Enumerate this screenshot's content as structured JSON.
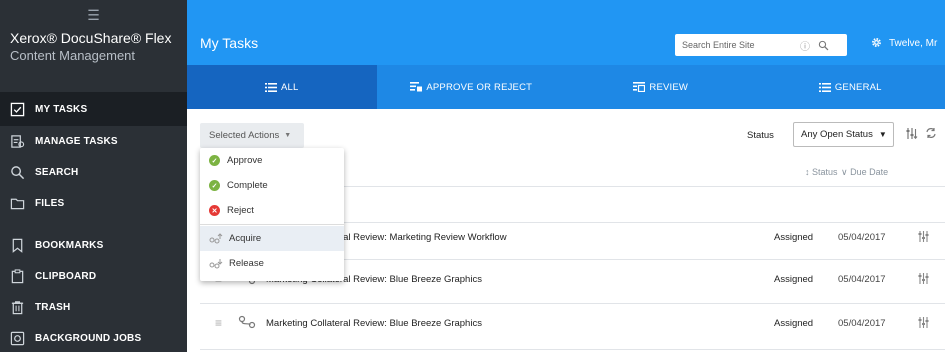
{
  "sidebar": {
    "brand": "Xerox® DocuShare® Flex",
    "brand_sub": "Content Management",
    "items": [
      {
        "label": "MY TASKS"
      },
      {
        "label": "MANAGE TASKS"
      },
      {
        "label": "SEARCH"
      },
      {
        "label": "FILES"
      },
      {
        "label": "BOOKMARKS"
      },
      {
        "label": "CLIPBOARD"
      },
      {
        "label": "TRASH"
      },
      {
        "label": "BACKGROUND JOBS"
      }
    ]
  },
  "header": {
    "title": "My Tasks",
    "search_placeholder": "Search Entire Site",
    "user": "Twelve, Mr"
  },
  "tabs": [
    {
      "label": "ALL"
    },
    {
      "label": "APPROVE OR REJECT"
    },
    {
      "label": "REVIEW"
    },
    {
      "label": "GENERAL"
    }
  ],
  "toolbar": {
    "selected_actions": "Selected Actions",
    "status_label": "Status",
    "status_value": "Any Open Status"
  },
  "columns": {
    "status": "↕ Status",
    "due_date": "∨ Due Date"
  },
  "rows": [
    {
      "name": "Marketing Collateral Review: Marketing Review Workflow",
      "status": "Assigned",
      "due": "05/04/2017"
    },
    {
      "name": "Marketing Collateral Review: Blue Breeze Graphics",
      "status": "Assigned",
      "due": "05/04/2017"
    },
    {
      "name": "Marketing Collateral Review: Blue Breeze Graphics",
      "status": "Assigned",
      "due": "05/04/2017"
    }
  ],
  "menu": {
    "items": [
      {
        "label": "Approve"
      },
      {
        "label": "Complete"
      },
      {
        "label": "Reject"
      },
      {
        "label": "Acquire"
      },
      {
        "label": "Release"
      }
    ]
  },
  "colors": {
    "topbar": "#2196f3",
    "tabs": "#1e88e5",
    "tab_active": "#1565c0",
    "sidebar": "#2b3036",
    "approve": "#7cb342",
    "reject": "#e53935"
  }
}
